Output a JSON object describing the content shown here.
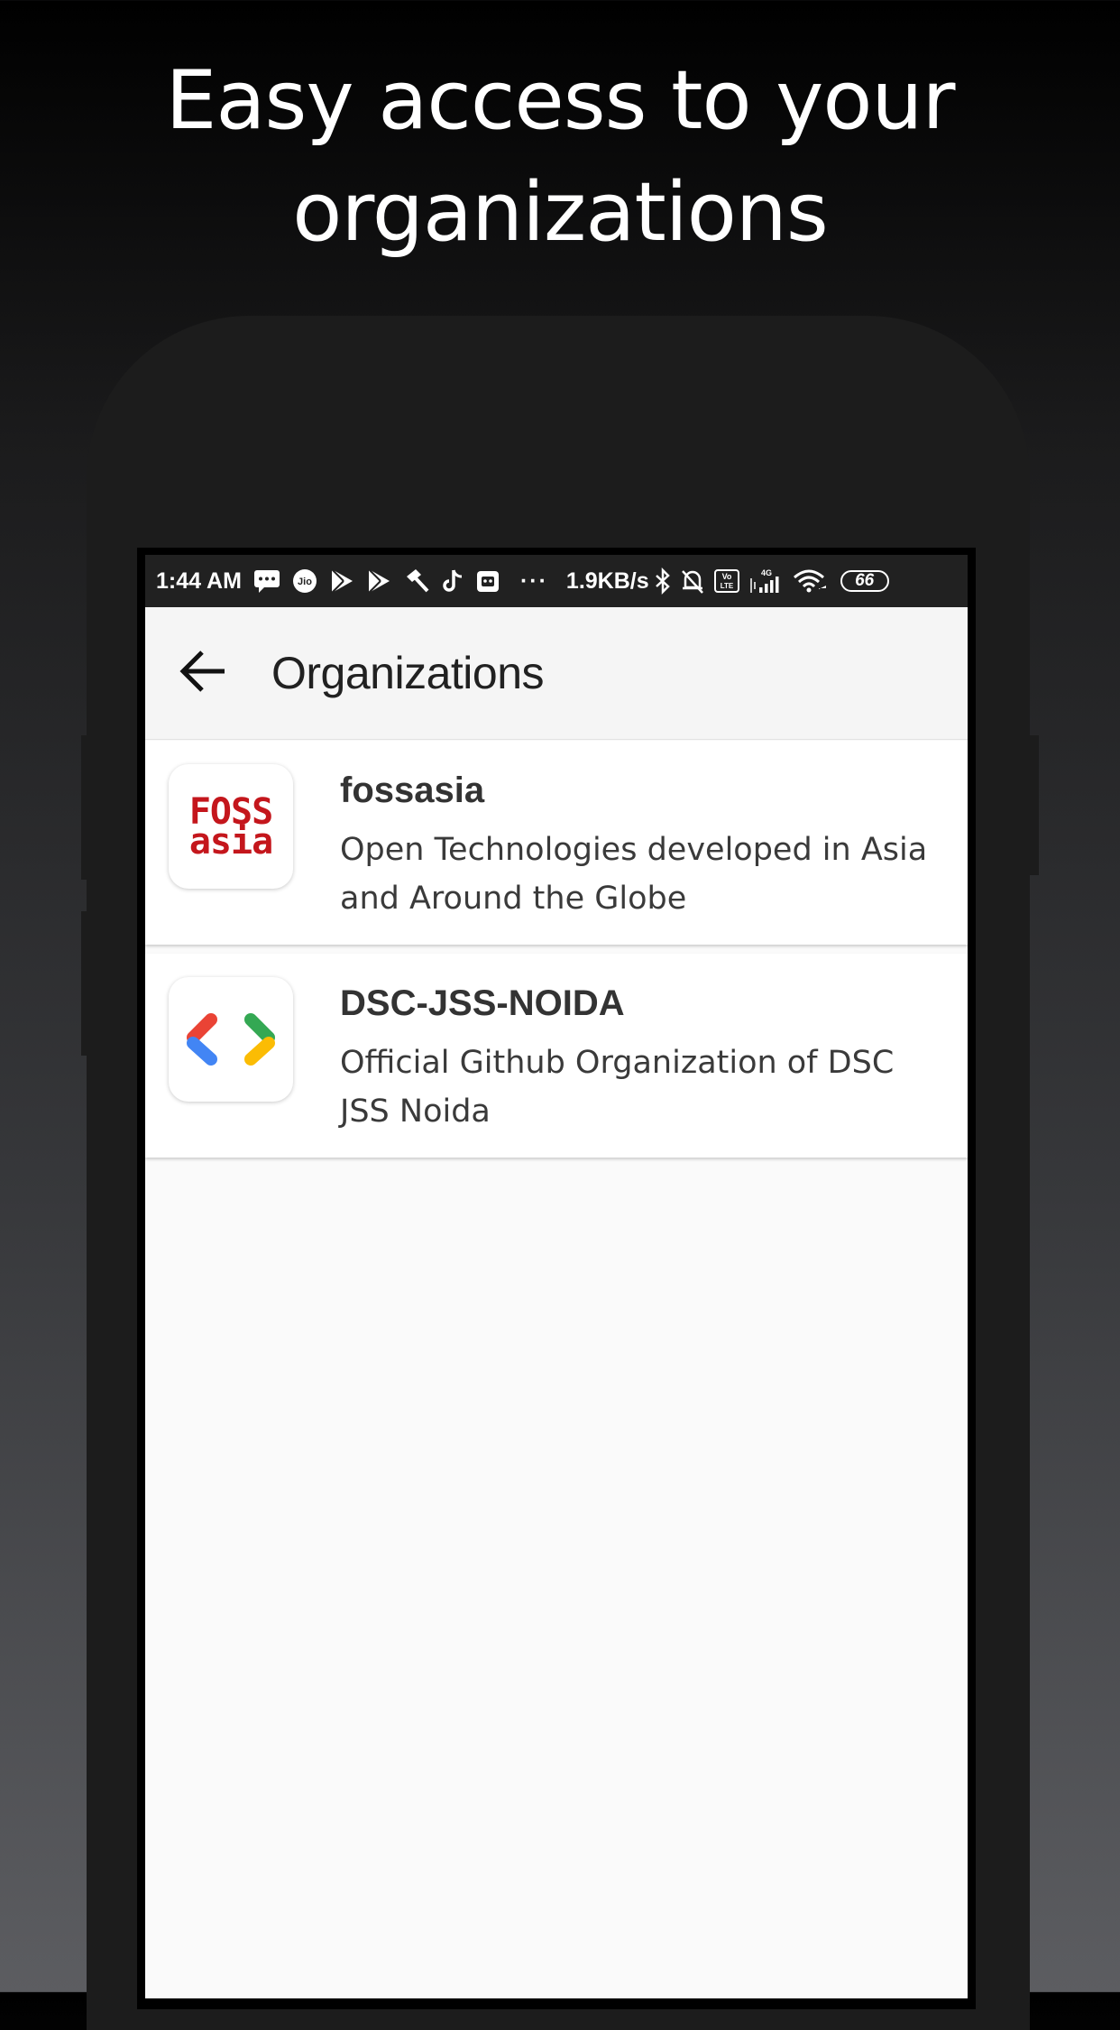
{
  "promo": {
    "headline_line1": "Easy access to your",
    "headline_line2": "organizations"
  },
  "status_bar": {
    "time": "1:44 AM",
    "network_speed": "1.9KB/s",
    "more_dots": "···",
    "battery": "66",
    "icons": [
      "message-icon",
      "jio-icon",
      "play-store-icon",
      "play-store-icon",
      "hammer-icon",
      "tiktok-icon",
      "box-icon",
      "bluetooth-icon",
      "alarm-off-icon",
      "volte-icon",
      "signal-4g-icon",
      "wifi-icon",
      "battery-icon"
    ]
  },
  "app_bar": {
    "back_icon": "arrow-back-icon",
    "title": "Organizations"
  },
  "organizations": [
    {
      "name": "fossasia",
      "description": "Open Technologies developed in Asia and Around the Globe",
      "logo_line1": "FOSS",
      "logo_line2": "asia",
      "logo_color": "#c4161c"
    },
    {
      "name": "DSC-JSS-NOIDA",
      "description": "Official Github Organization of DSC JSS Noida",
      "logo_icon": "dsc-brackets-icon",
      "logo_colors": [
        "#ea4335",
        "#4285f4",
        "#34a853",
        "#fbbc04"
      ]
    }
  ],
  "colors": {
    "status_bar_bg": "#212121",
    "app_bar_bg": "#f5f5f5",
    "screen_bg": "#fafafa"
  }
}
